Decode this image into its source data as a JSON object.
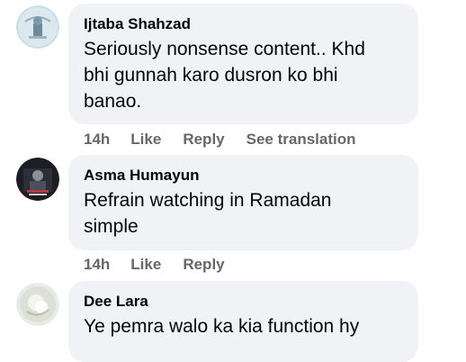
{
  "comments": [
    {
      "author": "Ijtaba Shahzad",
      "text": "Seriously nonsense content.. Khd\nbhi gunnah karo dusron ko bhi\nbanao.",
      "time": "14h",
      "like": "Like",
      "reply": "Reply",
      "translate": "See translation",
      "avatar_icon": "profile-photo"
    },
    {
      "author": "Asma Humayun",
      "text": "Refrain watching in Ramadan\nsimple",
      "time": "14h",
      "like": "Like",
      "reply": "Reply",
      "avatar_icon": "profile-photo"
    },
    {
      "author": "Dee Lara",
      "text": "Ye pemra walo ka kia function hy",
      "avatar_icon": "profile-photo"
    }
  ],
  "colors": {
    "bubble": "#f0f2f5",
    "meta": "#65676b",
    "text": "#050505"
  }
}
